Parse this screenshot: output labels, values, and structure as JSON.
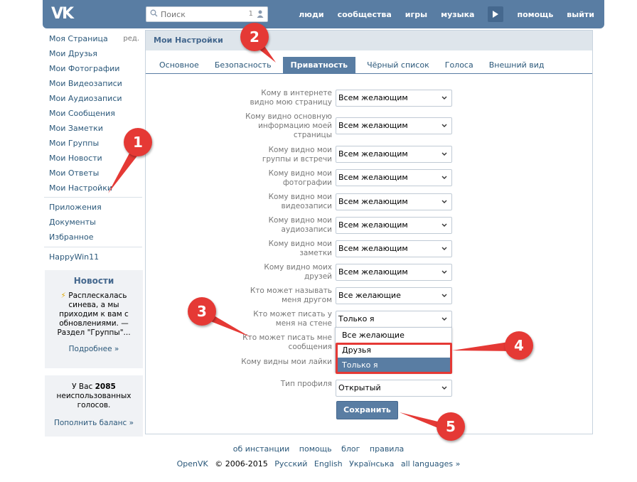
{
  "header": {
    "logo": "VK",
    "search_placeholder": "Поиск",
    "search_count": "1",
    "nav": [
      "люди",
      "сообщества",
      "игры",
      "музыка",
      "помощь",
      "выйти"
    ]
  },
  "sidebar": {
    "items": [
      {
        "label": "Моя Страница",
        "edit": "ред."
      },
      {
        "label": "Мои Друзья"
      },
      {
        "label": "Мои Фотографии"
      },
      {
        "label": "Мои Видеозаписи"
      },
      {
        "label": "Мои Аудиозаписи"
      },
      {
        "label": "Мои Сообщения"
      },
      {
        "label": "Мои Заметки"
      },
      {
        "label": "Мои Группы"
      },
      {
        "label": "Мои Новости"
      },
      {
        "label": "Мои Ответы"
      },
      {
        "label": "Мои Настройки"
      }
    ],
    "extra": [
      "Приложения",
      "Документы",
      "Избранное"
    ],
    "user": "HappyWin11"
  },
  "news": {
    "title": "Новости",
    "text": "Расплескалась синева, а мы приходим к вам с обновлениями. — Раздел \"Группы\"...",
    "more": "Подробнее »"
  },
  "votes": {
    "prefix": "У Вас",
    "count": "2085",
    "suffix": "неиспользованных голосов.",
    "link": "Пополнить баланс »"
  },
  "content": {
    "title": "Мои Настройки",
    "tabs": [
      "Основное",
      "Безопасность",
      "Приватность",
      "Чёрный список",
      "Голоса",
      "Внешний вид"
    ],
    "active_tab": "Приватность",
    "rows": [
      {
        "label": "Кому в интернете видно мою страницу",
        "value": "Всем желающим"
      },
      {
        "label": "Кому видно основную информацию моей страницы",
        "value": "Всем желающим"
      },
      {
        "label": "Кому видно мои группы и встречи",
        "value": "Всем желающим"
      },
      {
        "label": "Кому видно мои фотографии",
        "value": "Всем желающим"
      },
      {
        "label": "Кому видно мои видеозаписи",
        "value": "Всем желающим"
      },
      {
        "label": "Кому видно мои аудиозаписи",
        "value": "Всем желающим"
      },
      {
        "label": "Кому видно мои заметки",
        "value": "Всем желающим"
      },
      {
        "label": "Кому видно моих друзей",
        "value": "Всем желающим"
      },
      {
        "label": "Кто может называть меня другом",
        "value": "Все желающие"
      },
      {
        "label": "Кто может писать у меня на стене",
        "value": "Только я"
      },
      {
        "label": "Кто может писать мне сообщения",
        "value": ""
      },
      {
        "label": "Кому видны мои лайки",
        "value": ""
      },
      {
        "label": "Тип профиля",
        "value": "Открытый"
      }
    ],
    "dropdown_options": [
      "Все желающие",
      "Друзья",
      "Только я"
    ],
    "dropdown_highlighted": "Только я",
    "save": "Сохранить"
  },
  "footer": {
    "links": [
      "об инстанции",
      "помощь",
      "блог",
      "правила"
    ],
    "brand": "OpenVK",
    "copyright": "© 2006-2015",
    "langs": [
      "Русский",
      "English",
      "Українська",
      "all languages »"
    ]
  },
  "annotations": [
    "1",
    "2",
    "3",
    "4",
    "5"
  ],
  "colors": {
    "accent": "#597da3",
    "annotation": "#e53935",
    "link": "#2b587a"
  }
}
